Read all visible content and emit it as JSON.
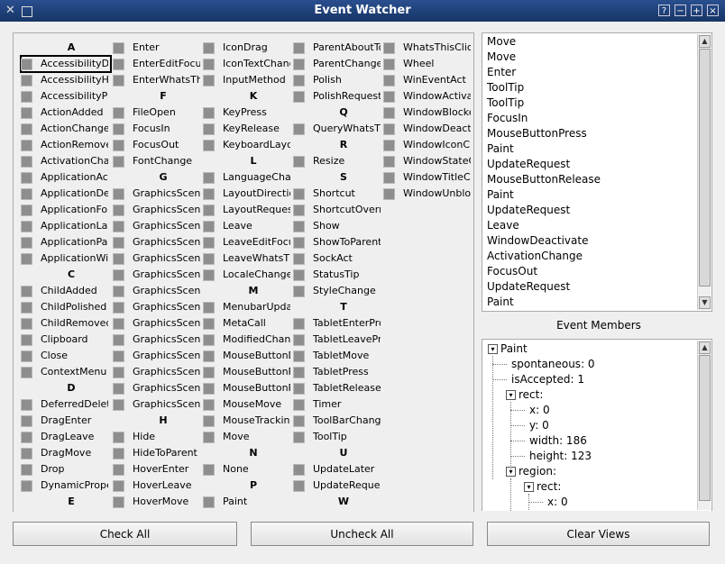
{
  "window": {
    "title": "Event Watcher"
  },
  "checkbox_columns": [
    [
      {
        "type": "header",
        "text": "A"
      },
      {
        "type": "item",
        "text": "AccessibilityDe",
        "focus": true
      },
      {
        "type": "item",
        "text": "AccessibilityHe"
      },
      {
        "type": "item",
        "text": "AccessibilityPr"
      },
      {
        "type": "item",
        "text": "ActionAdded"
      },
      {
        "type": "item",
        "text": "ActionChanged"
      },
      {
        "type": "item",
        "text": "ActionRemove"
      },
      {
        "type": "item",
        "text": "ActivationChan"
      },
      {
        "type": "item",
        "text": "ApplicationAct"
      },
      {
        "type": "item",
        "text": "ApplicationDea"
      },
      {
        "type": "item",
        "text": "ApplicationFon"
      },
      {
        "type": "item",
        "text": "ApplicationLay"
      },
      {
        "type": "item",
        "text": "ApplicationPal"
      },
      {
        "type": "item",
        "text": "ApplicationWir"
      },
      {
        "type": "header",
        "text": "C"
      },
      {
        "type": "item",
        "text": "ChildAdded"
      },
      {
        "type": "item",
        "text": "ChildPolished"
      },
      {
        "type": "item",
        "text": "ChildRemoved"
      },
      {
        "type": "item",
        "text": "Clipboard"
      },
      {
        "type": "item",
        "text": "Close"
      },
      {
        "type": "item",
        "text": "ContextMenu"
      },
      {
        "type": "header",
        "text": "D"
      },
      {
        "type": "item",
        "text": "DeferredDelete"
      },
      {
        "type": "item",
        "text": "DragEnter"
      },
      {
        "type": "item",
        "text": "DragLeave"
      },
      {
        "type": "item",
        "text": "DragMove"
      },
      {
        "type": "item",
        "text": "Drop"
      },
      {
        "type": "item",
        "text": "DynamicPrope"
      },
      {
        "type": "header",
        "text": "E"
      }
    ],
    [
      {
        "type": "item",
        "text": "Enter"
      },
      {
        "type": "item",
        "text": "EnterEditFocus"
      },
      {
        "type": "item",
        "text": "EnterWhatsThis"
      },
      {
        "type": "header",
        "text": "F"
      },
      {
        "type": "item",
        "text": "FileOpen"
      },
      {
        "type": "item",
        "text": "FocusIn"
      },
      {
        "type": "item",
        "text": "FocusOut"
      },
      {
        "type": "item",
        "text": "FontChange"
      },
      {
        "type": "header",
        "text": "G"
      },
      {
        "type": "item",
        "text": "GraphicsScene"
      },
      {
        "type": "item",
        "text": "GraphicsScene"
      },
      {
        "type": "item",
        "text": "GraphicsScene"
      },
      {
        "type": "item",
        "text": "GraphicsScene"
      },
      {
        "type": "item",
        "text": "GraphicsScene"
      },
      {
        "type": "item",
        "text": "GraphicsScene"
      },
      {
        "type": "item",
        "text": "GraphicsScene"
      },
      {
        "type": "item",
        "text": "GraphicsScene"
      },
      {
        "type": "item",
        "text": "GraphicsScene"
      },
      {
        "type": "item",
        "text": "GraphicsScene"
      },
      {
        "type": "item",
        "text": "GraphicsScene"
      },
      {
        "type": "item",
        "text": "GraphicsScene"
      },
      {
        "type": "item",
        "text": "GraphicsScene"
      },
      {
        "type": "item",
        "text": "GraphicsScene"
      },
      {
        "type": "header",
        "text": "H"
      },
      {
        "type": "item",
        "text": "Hide"
      },
      {
        "type": "item",
        "text": "HideToParent"
      },
      {
        "type": "item",
        "text": "HoverEnter"
      },
      {
        "type": "item",
        "text": "HoverLeave"
      },
      {
        "type": "item",
        "text": "HoverMove"
      }
    ],
    [
      {
        "type": "item",
        "text": "IconDrag"
      },
      {
        "type": "item",
        "text": "IconTextChange"
      },
      {
        "type": "item",
        "text": "InputMethod"
      },
      {
        "type": "header",
        "text": "K"
      },
      {
        "type": "item",
        "text": "KeyPress"
      },
      {
        "type": "item",
        "text": "KeyRelease"
      },
      {
        "type": "item",
        "text": "KeyboardLayou"
      },
      {
        "type": "header",
        "text": "L"
      },
      {
        "type": "item",
        "text": "LanguageChan"
      },
      {
        "type": "item",
        "text": "LayoutDirectio"
      },
      {
        "type": "item",
        "text": "LayoutRequest"
      },
      {
        "type": "item",
        "text": "Leave"
      },
      {
        "type": "item",
        "text": "LeaveEditFocu"
      },
      {
        "type": "item",
        "text": "LeaveWhatsTh"
      },
      {
        "type": "item",
        "text": "LocaleChange"
      },
      {
        "type": "header",
        "text": "M"
      },
      {
        "type": "item",
        "text": "MenubarUpdat"
      },
      {
        "type": "item",
        "text": "MetaCall"
      },
      {
        "type": "item",
        "text": "ModifiedChang"
      },
      {
        "type": "item",
        "text": "MouseButtonD"
      },
      {
        "type": "item",
        "text": "MouseButtonPr"
      },
      {
        "type": "item",
        "text": "MouseButtonRe"
      },
      {
        "type": "item",
        "text": "MouseMove"
      },
      {
        "type": "item",
        "text": "MouseTracking"
      },
      {
        "type": "item",
        "text": "Move"
      },
      {
        "type": "header",
        "text": "N"
      },
      {
        "type": "item",
        "text": "None"
      },
      {
        "type": "header",
        "text": "P"
      },
      {
        "type": "item",
        "text": "Paint"
      }
    ],
    [
      {
        "type": "item",
        "text": "ParentAboutTo"
      },
      {
        "type": "item",
        "text": "ParentChange"
      },
      {
        "type": "item",
        "text": "Polish"
      },
      {
        "type": "item",
        "text": "PolishRequest"
      },
      {
        "type": "header",
        "text": "Q"
      },
      {
        "type": "item",
        "text": "QueryWhatsTh"
      },
      {
        "type": "header",
        "text": "R"
      },
      {
        "type": "item",
        "text": "Resize"
      },
      {
        "type": "header",
        "text": "S"
      },
      {
        "type": "item",
        "text": "Shortcut"
      },
      {
        "type": "item",
        "text": "ShortcutOverri"
      },
      {
        "type": "item",
        "text": "Show"
      },
      {
        "type": "item",
        "text": "ShowToParent"
      },
      {
        "type": "item",
        "text": "SockAct"
      },
      {
        "type": "item",
        "text": "StatusTip"
      },
      {
        "type": "item",
        "text": "StyleChange"
      },
      {
        "type": "header",
        "text": "T"
      },
      {
        "type": "item",
        "text": "TabletEnterPro"
      },
      {
        "type": "item",
        "text": "TabletLeavePro"
      },
      {
        "type": "item",
        "text": "TabletMove"
      },
      {
        "type": "item",
        "text": "TabletPress"
      },
      {
        "type": "item",
        "text": "TabletRelease"
      },
      {
        "type": "item",
        "text": "Timer"
      },
      {
        "type": "item",
        "text": "ToolBarChange"
      },
      {
        "type": "item",
        "text": "ToolTip"
      },
      {
        "type": "header",
        "text": "U"
      },
      {
        "type": "item",
        "text": "UpdateLater"
      },
      {
        "type": "item",
        "text": "UpdateRequest"
      },
      {
        "type": "header",
        "text": "W"
      }
    ],
    [
      {
        "type": "item",
        "text": "WhatsThisClick"
      },
      {
        "type": "item",
        "text": "Wheel"
      },
      {
        "type": "item",
        "text": "WinEventAct"
      },
      {
        "type": "item",
        "text": "WindowActivat"
      },
      {
        "type": "item",
        "text": "WindowBlocke"
      },
      {
        "type": "item",
        "text": "WindowDeactiv"
      },
      {
        "type": "item",
        "text": "WindowIconCh"
      },
      {
        "type": "item",
        "text": "WindowStateCh"
      },
      {
        "type": "item",
        "text": "WindowTitleCh"
      },
      {
        "type": "item",
        "text": "WindowUnbloc"
      }
    ]
  ],
  "event_log": [
    "Move",
    "Move",
    "Enter",
    "ToolTip",
    "ToolTip",
    "FocusIn",
    "MouseButtonPress",
    "Paint",
    "UpdateRequest",
    "MouseButtonRelease",
    "Paint",
    "UpdateRequest",
    "Leave",
    "WindowDeactivate",
    "ActivationChange",
    "FocusOut",
    "UpdateRequest",
    "Paint"
  ],
  "event_members": {
    "label": "Event Members",
    "tree": [
      {
        "depth": 0,
        "text": "Paint",
        "expander": "minus"
      },
      {
        "depth": 1,
        "text": "spontaneous: 0"
      },
      {
        "depth": 1,
        "text": "isAccepted: 1"
      },
      {
        "depth": 1,
        "text": "rect:",
        "expander": "minus"
      },
      {
        "depth": 2,
        "text": "x: 0"
      },
      {
        "depth": 2,
        "text": "y: 0"
      },
      {
        "depth": 2,
        "text": "width: 186"
      },
      {
        "depth": 2,
        "text": "height: 123"
      },
      {
        "depth": 1,
        "text": "region:",
        "expander": "minus"
      },
      {
        "depth": 2,
        "text": "rect:",
        "expander": "minus"
      },
      {
        "depth": 3,
        "text": "x: 0"
      }
    ]
  },
  "buttons": {
    "check_all": "Check All",
    "uncheck_all": "Uncheck All",
    "clear_views": "Clear Views"
  }
}
